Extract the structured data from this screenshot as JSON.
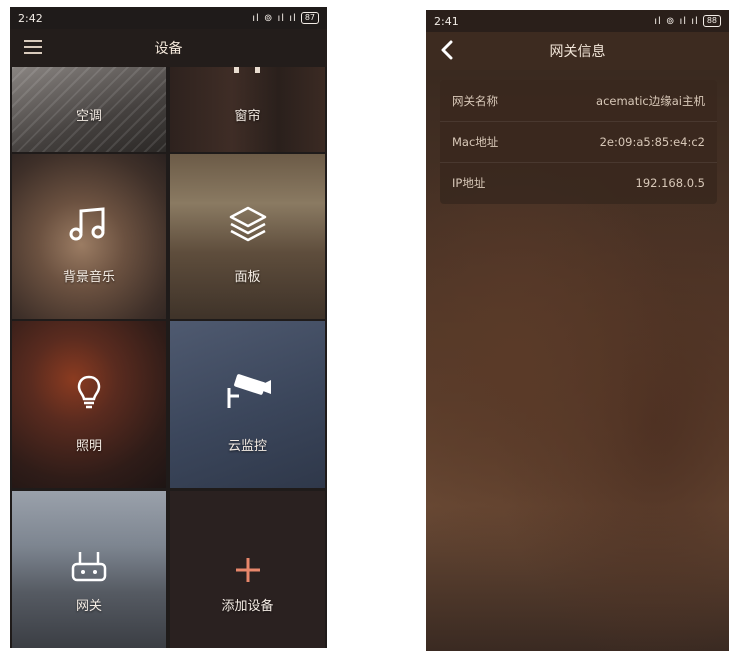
{
  "left_screen": {
    "status": {
      "time": "2:42",
      "battery": "87"
    },
    "title": "设备",
    "tiles": [
      {
        "label": "空调",
        "icon": "ceiling-ac-image"
      },
      {
        "label": "窗帘",
        "icon": "curtain-image"
      },
      {
        "label": "背景音乐",
        "icon": "music-note-icon"
      },
      {
        "label": "面板",
        "icon": "layers-icon"
      },
      {
        "label": "照明",
        "icon": "light-bulb-icon"
      },
      {
        "label": "云监控",
        "icon": "security-camera-icon"
      },
      {
        "label": "网关",
        "icon": "router-icon"
      },
      {
        "label": "添加设备",
        "icon": "plus-icon"
      }
    ]
  },
  "right_screen": {
    "status": {
      "time": "2:41",
      "battery": "88"
    },
    "title": "网关信息",
    "rows": [
      {
        "key": "网关名称",
        "value": "acematic边缘ai主机"
      },
      {
        "key": "Mac地址",
        "value": "2e:09:a5:85:e4:c2"
      },
      {
        "key": "IP地址",
        "value": "192.168.0.5"
      }
    ]
  },
  "colors": {
    "accent": "#e8876b",
    "text": "#f4ece4",
    "card": "#3a281e"
  }
}
